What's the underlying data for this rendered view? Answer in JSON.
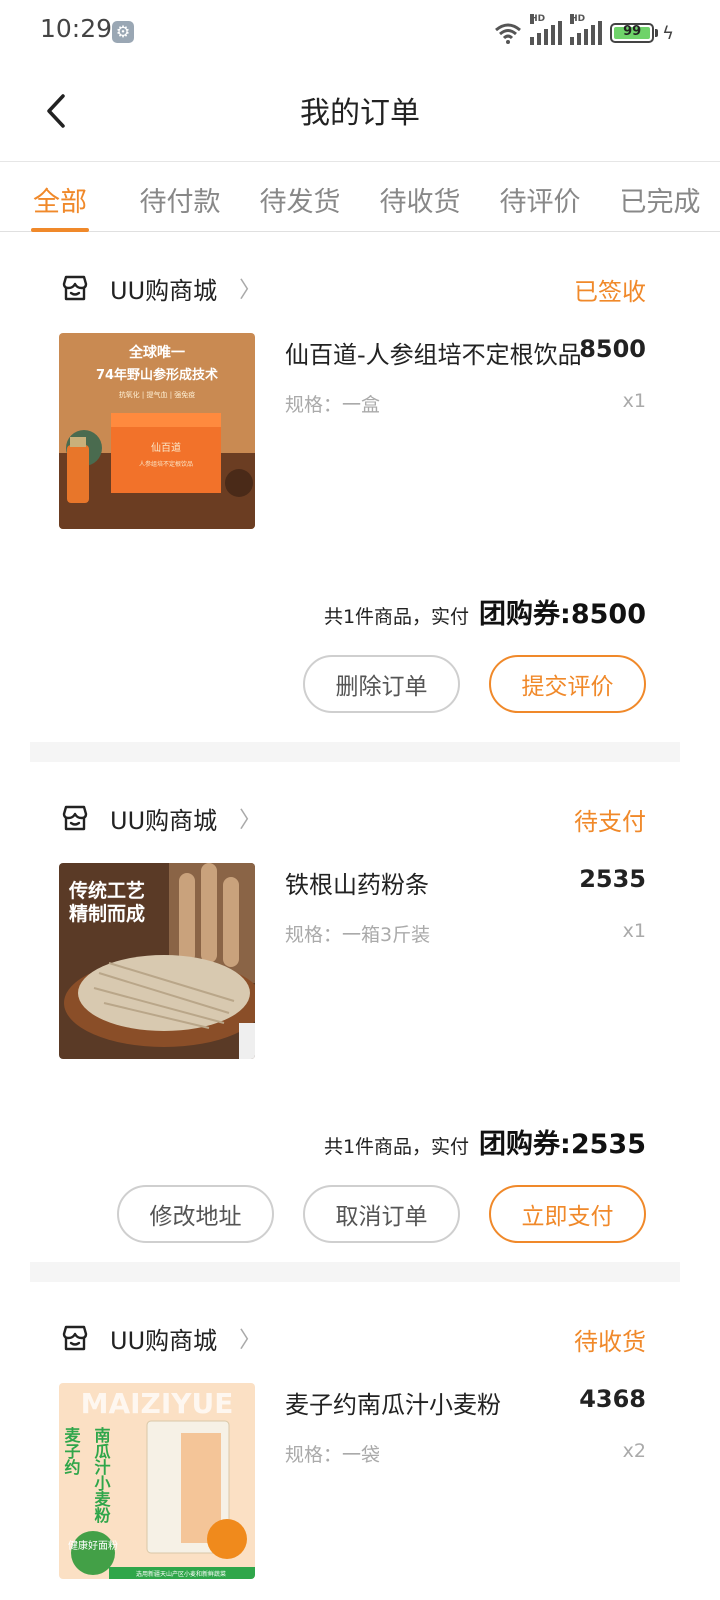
{
  "status_bar": {
    "time": "10:29",
    "battery": "99",
    "battery_level": 0.99,
    "signal_1_label": "HD",
    "signal_2_label": "HD"
  },
  "header": {
    "title": "我的订单"
  },
  "tabs": [
    {
      "label": "全部",
      "active": true
    },
    {
      "label": "待付款",
      "active": false
    },
    {
      "label": "待发货",
      "active": false
    },
    {
      "label": "待收货",
      "active": false
    },
    {
      "label": "待评价",
      "active": false
    },
    {
      "label": "已完成",
      "active": false
    }
  ],
  "orders": [
    {
      "store": "UU购商城",
      "status": "已签收",
      "product": {
        "name": "仙百道-人参组培不定根饮品",
        "price": "8500",
        "spec": "规格：一盒",
        "qty": "x1",
        "image_text": [
          "全球唯一",
          "74年野山参形成技术",
          "抗氧化  |  提气血  |  强免疫",
          "仙百道",
          "人参组培不定根饮品"
        ]
      },
      "summary": "共1件商品，实付",
      "total": "团购券:8500",
      "buttons": [
        "删除订单",
        "提交评价"
      ]
    },
    {
      "store": "UU购商城",
      "status": "待支付",
      "product": {
        "name": "铁根山药粉条",
        "price": "2535",
        "spec": "规格：一箱3斤装",
        "qty": "x1",
        "image_text": [
          "传统工艺",
          "精制而成"
        ]
      },
      "summary": "共1件商品，实付",
      "total": "团购券:2535",
      "buttons": [
        "修改地址",
        "取消订单",
        "立即支付"
      ]
    },
    {
      "store": "UU购商城",
      "status": "待收货",
      "product": {
        "name": "麦子约南瓜汁小麦粉",
        "price": "4368",
        "spec": "规格：一袋",
        "qty": "x2",
        "image_text": [
          "MAIZIYUE",
          "麦子约",
          "南瓜汁小麦粉",
          "健康好面粉",
          "选用新疆天山产区小麦和新鲜蔬菜"
        ]
      }
    }
  ],
  "colors": {
    "accent": "#f0892a",
    "text": "#222222",
    "muted": "#aaaaaa",
    "separator": "#f5f5f5"
  }
}
